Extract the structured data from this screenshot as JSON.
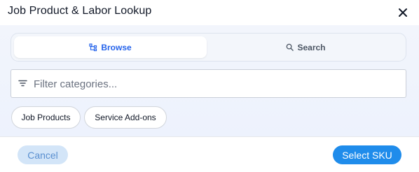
{
  "dialog": {
    "title": "Job Product & Labor Lookup",
    "close_icon": "close-icon"
  },
  "tabs": [
    {
      "label": "Browse",
      "icon": "hierarchy-icon",
      "active": true
    },
    {
      "label": "Search",
      "icon": "search-icon",
      "active": false
    }
  ],
  "filter": {
    "placeholder": "Filter categories...",
    "value": "",
    "icon": "filter-icon"
  },
  "categories": [
    {
      "label": "Job Products"
    },
    {
      "label": "Service Add-ons"
    }
  ],
  "footer": {
    "cancel_label": "Cancel",
    "primary_label": "Select SKU"
  },
  "colors": {
    "accent": "#2563eb",
    "primary_button": "#1f8ceb",
    "cancel_button_bg": "#d3e5f8"
  }
}
